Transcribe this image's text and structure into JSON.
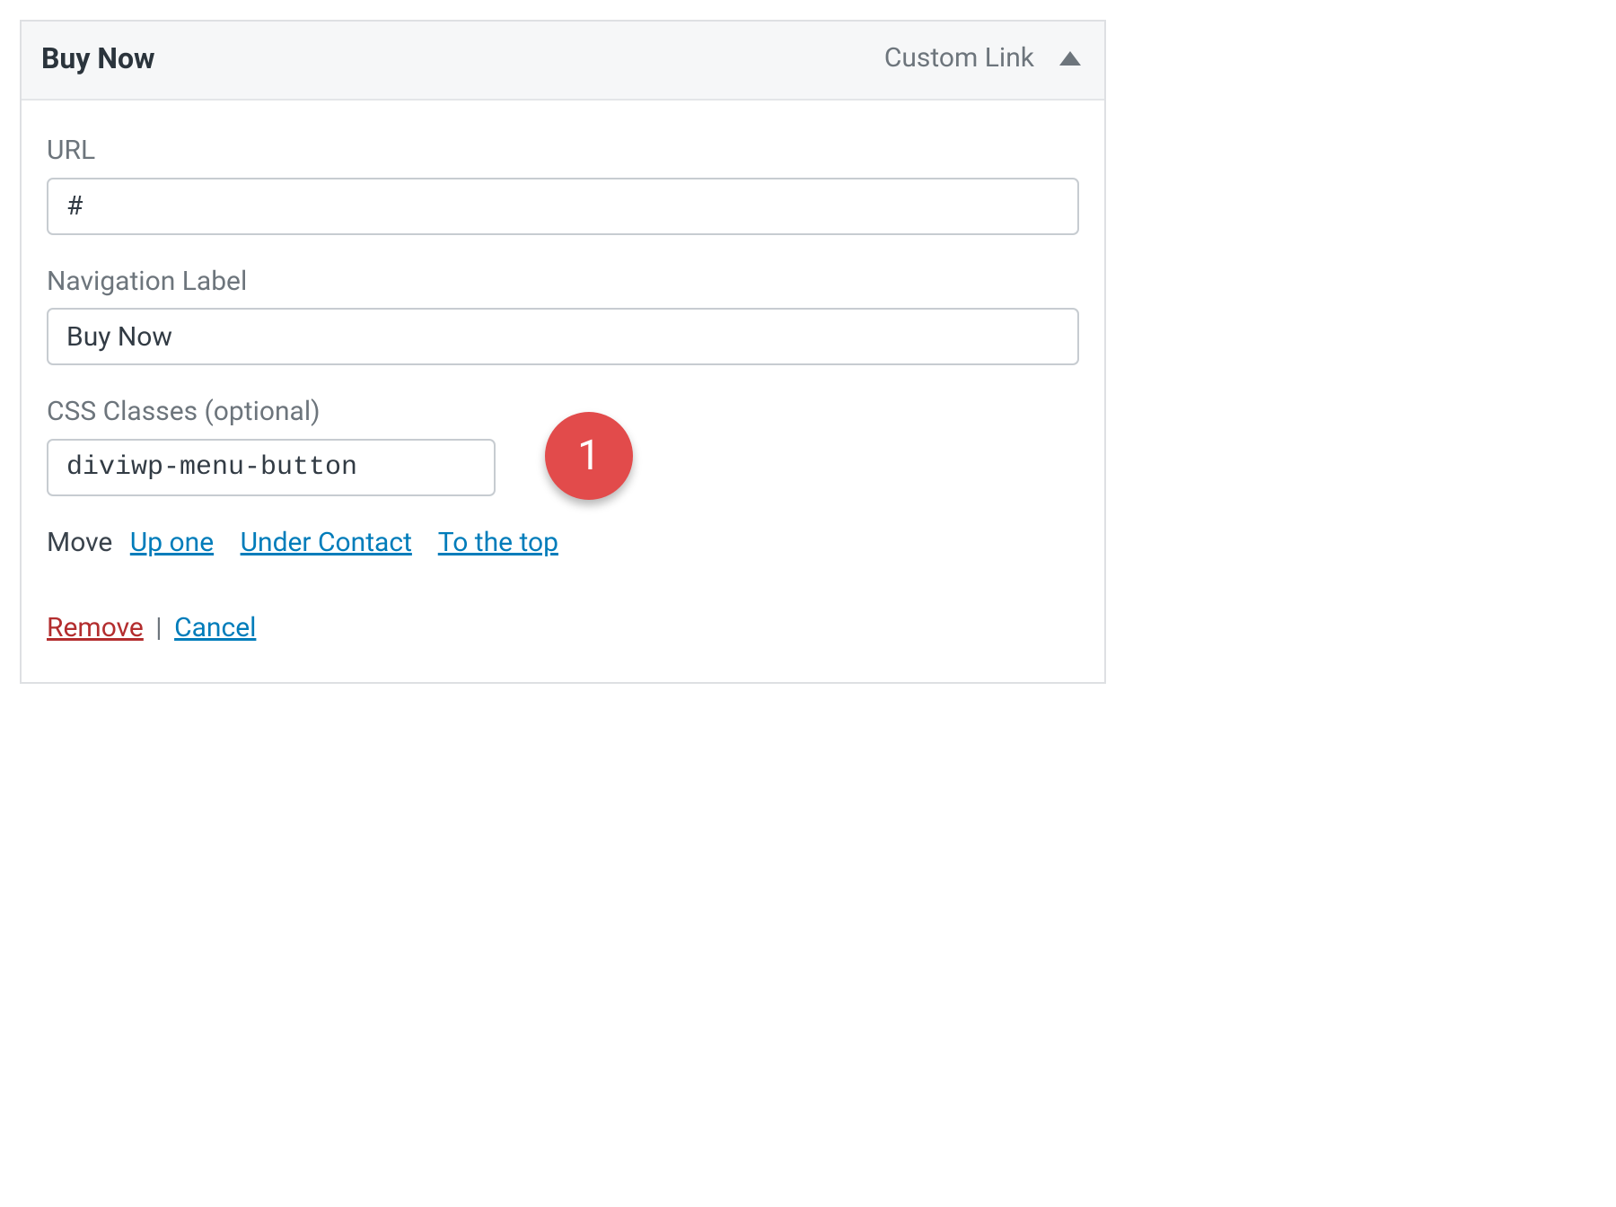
{
  "panel": {
    "title": "Buy Now",
    "type": "Custom Link"
  },
  "fields": {
    "url": {
      "label": "URL",
      "value": "#"
    },
    "nav_label": {
      "label": "Navigation Label",
      "value": "Buy Now"
    },
    "css_classes": {
      "label": "CSS Classes (optional)",
      "value": "diviwp-menu-button"
    }
  },
  "move": {
    "label": "Move",
    "up_one": "Up one",
    "under": "Under Contact",
    "to_top": "To the top"
  },
  "actions": {
    "remove": "Remove",
    "separator": "|",
    "cancel": "Cancel"
  },
  "annotation": {
    "badge_number": "1"
  }
}
